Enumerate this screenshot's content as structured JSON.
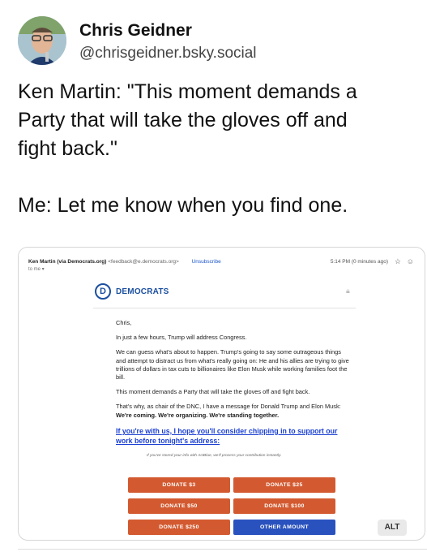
{
  "author": {
    "name": "Chris Geidner",
    "handle": "@chrisgeidner.bsky.social"
  },
  "post": {
    "lines": [
      "Ken Martin: \"This moment demands a",
      "Party that will take the gloves off and",
      "fight back.\"",
      "Me: Let me know when you find one."
    ]
  },
  "email": {
    "sender_name": "Ken Martin (via Democrats.org)",
    "sender_address": "<feedback@e.democrats.org>",
    "unsubscribe": "Unsubscribe",
    "to_me": "to me ▾",
    "time": "5:14 PM (0 minutes ago)",
    "brand": "DEMOCRATS",
    "brand_letter": "D",
    "greeting": "Chris,",
    "p1": "In just a few hours, Trump will address Congress.",
    "p2": "We can guess what's about to happen. Trump's going to say some outrageous things and attempt to distract us from what's really going on: He and his allies are trying to give trillions of dollars in tax cuts to billionaires like Elon Musk while working families foot the bill.",
    "p3": "This moment demands a Party that will take the gloves off and fight back.",
    "p4_start": "That's why, as chair of the DNC, I have a message for Donald Trump and Elon Musk: ",
    "p4_bold": "We're coming. We're organizing. We're standing together.",
    "cta": "If you're with us, I hope you'll consider chipping in to support our work before tonight's address:",
    "fine_print": "If you've stored your info with ActBlue, we'll process your contribution instantly.",
    "buttons": [
      "DONATE $3",
      "DONATE $25",
      "DONATE $50",
      "DONATE $100",
      "DONATE $250",
      "OTHER AMOUNT"
    ]
  },
  "alt_label": "ALT",
  "colors": {
    "donate": "#d35a30",
    "other": "#2a52be",
    "brand": "#1b4fa0",
    "link": "#1a3fd1"
  }
}
